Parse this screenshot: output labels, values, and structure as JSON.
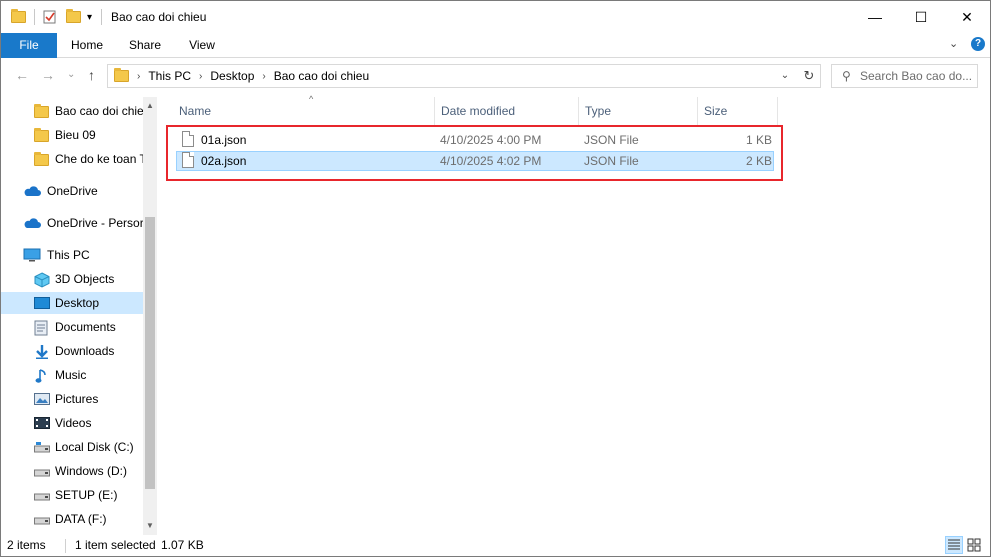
{
  "window": {
    "title": "Bao cao doi chieu",
    "minimize_glyph": "—",
    "maximize_glyph": "☐",
    "close_glyph": "✕"
  },
  "ribbon": {
    "tabs": [
      "File",
      "Home",
      "Share",
      "View"
    ],
    "expand_glyph": "⌄",
    "help_glyph": "?"
  },
  "nav": {
    "back_glyph": "←",
    "forward_glyph": "→",
    "recent_glyph": "⌄",
    "up_glyph": "↑"
  },
  "address": {
    "crumbs": [
      "This PC",
      "Desktop",
      "Bao cao doi chieu"
    ],
    "separator_glyph": "›",
    "dropdown_glyph": "⌄",
    "refresh_glyph": "↻"
  },
  "search": {
    "placeholder": "Search Bao cao do...",
    "icon_glyph": "⚲"
  },
  "navpane": {
    "items": [
      {
        "label": "Bao cao doi chie",
        "icon": "folder-icon"
      },
      {
        "label": "Bieu 09",
        "icon": "folder-icon"
      },
      {
        "label": "Che do ke toan T",
        "icon": "folder-icon"
      },
      {
        "label": "OneDrive",
        "icon": "cloud-icon"
      },
      {
        "label": "OneDrive - Persor",
        "icon": "cloud-icon"
      },
      {
        "label": "This PC",
        "icon": "computer-icon"
      },
      {
        "label": "3D Objects",
        "icon": "cube-icon"
      },
      {
        "label": "Desktop",
        "icon": "desktop-icon"
      },
      {
        "label": "Documents",
        "icon": "document-icon"
      },
      {
        "label": "Downloads",
        "icon": "download-icon"
      },
      {
        "label": "Music",
        "icon": "music-icon"
      },
      {
        "label": "Pictures",
        "icon": "picture-icon"
      },
      {
        "label": "Videos",
        "icon": "video-icon"
      },
      {
        "label": "Local Disk (C:)",
        "icon": "drive-icon"
      },
      {
        "label": "Windows (D:)",
        "icon": "drive-icon"
      },
      {
        "label": "SETUP (E:)",
        "icon": "drive-icon"
      },
      {
        "label": "DATA (F:)",
        "icon": "drive-icon"
      }
    ],
    "selected": "Desktop",
    "scroll_up_glyph": "▲",
    "scroll_down_glyph": "▼"
  },
  "filelist": {
    "columns": [
      "Name",
      "Date modified",
      "Type",
      "Size"
    ],
    "sort_glyph": "^",
    "rows": [
      {
        "name": "01a.json",
        "date": "4/10/2025 4:00 PM",
        "type": "JSON File",
        "size": "1 KB",
        "selected": false
      },
      {
        "name": "02a.json",
        "date": "4/10/2025 4:02 PM",
        "type": "JSON File",
        "size": "2 KB",
        "selected": true
      }
    ]
  },
  "statusbar": {
    "item_count": "2 items",
    "selection": "1 item selected",
    "selection_size": "1.07 KB"
  },
  "colors": {
    "accent": "#1979ca",
    "selection": "#cce8ff",
    "selection_border": "#99d1ff",
    "highlight": "#e8262c"
  }
}
